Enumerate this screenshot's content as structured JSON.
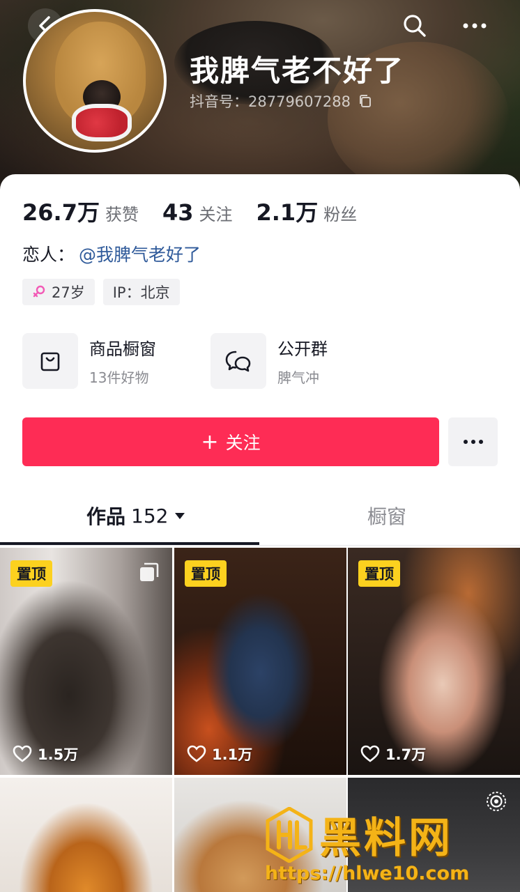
{
  "header": {
    "nickname": "我脾气老不好了",
    "douyin_id": "抖音号：28779607288",
    "icons": [
      "back-icon",
      "search-icon",
      "more-icon",
      "copy-icon"
    ]
  },
  "stats": [
    {
      "value": "26.7万",
      "label": "获赞"
    },
    {
      "value": "43",
      "label": "关注"
    },
    {
      "value": "2.1万",
      "label": "粉丝"
    }
  ],
  "lover": {
    "label": "恋人：",
    "link": "@我脾气老好了"
  },
  "tags": {
    "age": "27岁",
    "ip": "IP：北京",
    "gender_icon": "female-icon"
  },
  "features": [
    {
      "title": "商品橱窗",
      "subtitle": "13件好物",
      "icon": "shopping-bag-icon"
    },
    {
      "title": "公开群",
      "subtitle": "脾气冲",
      "icon": "chat-bubble-icon"
    }
  ],
  "actions": {
    "follow_label": "关注",
    "follow_plus": "+",
    "more_icon": "ellipsis-icon"
  },
  "tabs": {
    "works_label": "作品",
    "works_count": "152",
    "shop_label": "橱窗"
  },
  "videos": [
    {
      "pinned": "置顶",
      "likes": "1.5万",
      "multi_image": true
    },
    {
      "pinned": "置顶",
      "likes": "1.1万"
    },
    {
      "pinned": "置顶",
      "likes": "1.7万"
    },
    {},
    {},
    {}
  ],
  "watermark": {
    "title": "黑料网",
    "url": "https://hlwe10.com"
  },
  "colors": {
    "accent": "#fe2c55",
    "pin_badge": "#fcd11f",
    "link": "#2f5a9a",
    "watermark": "#f4b317"
  }
}
